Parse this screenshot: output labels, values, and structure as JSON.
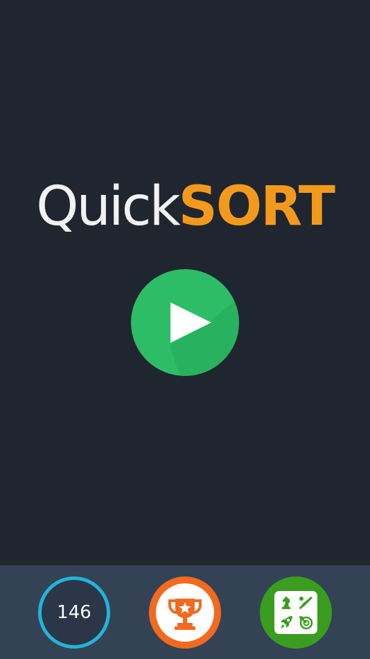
{
  "logo": {
    "part1": "Quick",
    "part2": "SORT"
  },
  "play_button": {
    "icon": "play-icon",
    "color": "#2ebd67"
  },
  "bottom_bar": {
    "score": {
      "value": "146",
      "ring_color": "#22b4d8"
    },
    "leaderboard": {
      "icon": "trophy-icon",
      "color": "#f26a1f"
    },
    "powerups": {
      "icons": [
        "chess-knight-icon",
        "baseball-bat-icon",
        "rocket-icon",
        "timer-icon"
      ],
      "color": "#3a9d1f"
    }
  },
  "colors": {
    "background": "#20262f",
    "bar": "#344256",
    "accent": "#f39a1c"
  }
}
